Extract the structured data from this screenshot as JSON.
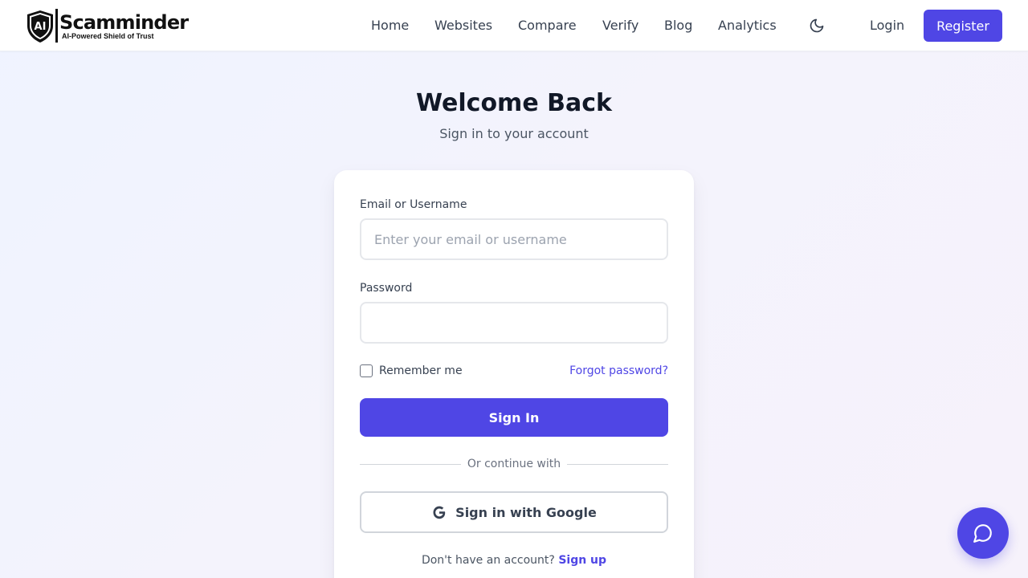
{
  "brand": {
    "name": "Scamminder",
    "tagline": "AI-Powered Shield of Trust",
    "shield_text": "AI"
  },
  "nav": {
    "items": [
      "Home",
      "Websites",
      "Compare",
      "Verify",
      "Blog",
      "Analytics"
    ],
    "theme_icon": "moon-icon",
    "login": "Login",
    "register": "Register"
  },
  "page": {
    "title": "Welcome Back",
    "subtitle": "Sign in to your account"
  },
  "form": {
    "email_label": "Email or Username",
    "email_placeholder": "Enter your email or username",
    "email_value": "",
    "password_label": "Password",
    "password_value": "",
    "remember_label": "Remember me",
    "remember_checked": false,
    "forgot_label": "Forgot password?",
    "signin_label": "Sign In",
    "divider_text": "Or continue with",
    "google_label": "Sign in with Google",
    "signup_prompt": "Don't have an account?",
    "signup_link": "Sign up"
  },
  "colors": {
    "accent": "#4f46e5",
    "text_primary": "#111827",
    "text_secondary": "#4b5563"
  },
  "chat": {
    "icon": "chat-bubble-icon"
  }
}
